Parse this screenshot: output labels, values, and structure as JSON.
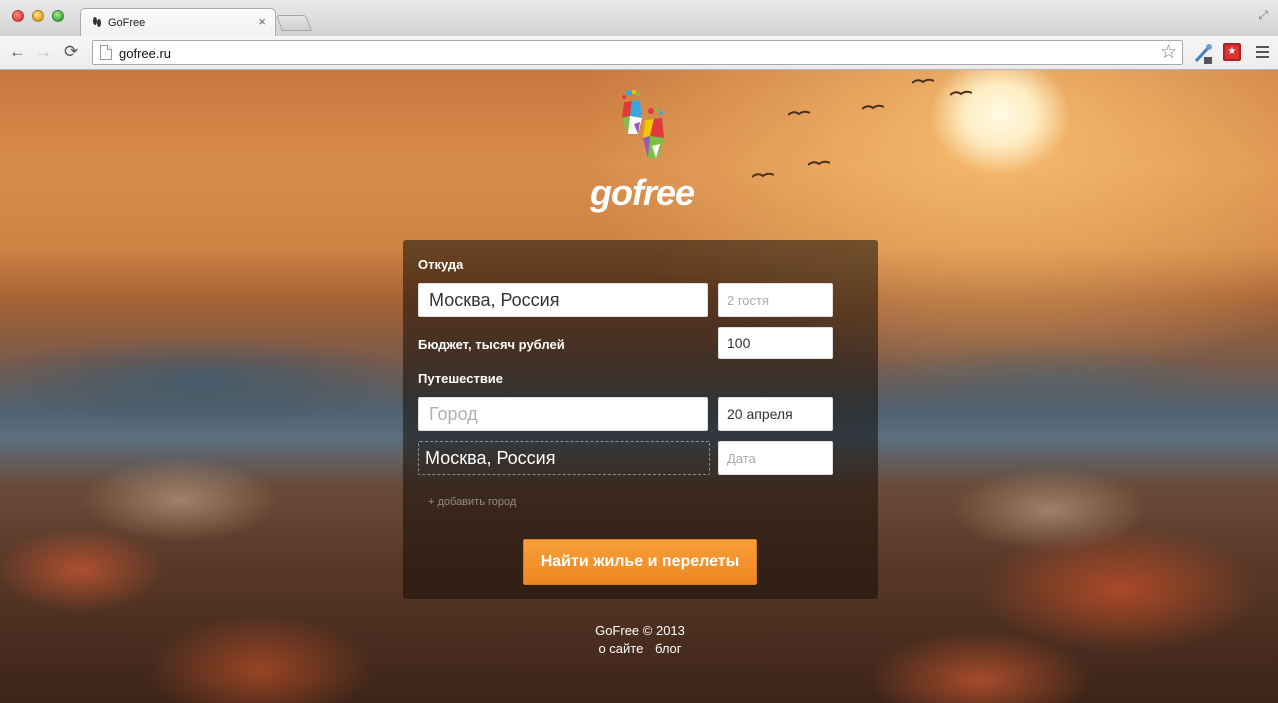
{
  "browser": {
    "tab_title": "GoFree",
    "tab_close": "×",
    "url": "gofree.ru",
    "back": "←",
    "forward": "→",
    "reload": "⟳",
    "star": "☆",
    "ext_label": "★",
    "fullscreen": "⤢"
  },
  "brand": {
    "name": "gofree"
  },
  "form": {
    "from_label": "Откуда",
    "from_value": "Москва, Россия",
    "guests_placeholder": "2 гостя",
    "budget_label": "Бюджет, тысяч рублей",
    "budget_value": "100",
    "trip_label": "Путешествие",
    "city_placeholder": "Город",
    "date1_value": "20 апреля",
    "return_city": "Москва, Россия",
    "date2_placeholder": "Дата",
    "add_city": "+ добавить город",
    "submit": "Найти жилье и перелеты"
  },
  "footer": {
    "copyright": "GoFree © 2013",
    "about": "о сайте",
    "blog": "блог"
  }
}
